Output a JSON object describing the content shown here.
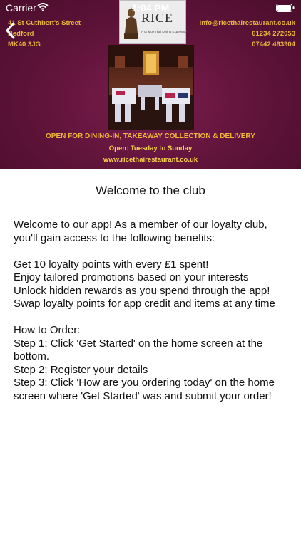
{
  "status_bar": {
    "carrier": "Carrier",
    "time": "1:04 PM"
  },
  "banner": {
    "address": [
      "41 St Cuthbert's Street",
      "Bedford",
      "MK40 3JG"
    ],
    "contact": [
      "info@ricethairestaurant.co.uk",
      "01234 272053",
      "07442 493904"
    ],
    "logo_text": "RICE",
    "logo_subtitle": "A Unique Thai Dining Experience",
    "tagline": "OPEN FOR DINING-IN, TAKEAWAY COLLECTION & DELIVERY",
    "hours": "Open: Tuesday to Sunday",
    "website": "www.ricethairestaurant.co.uk"
  },
  "content": {
    "title": "Welcome to the club",
    "intro": "Welcome to our app! As a member of our loyalty club, you'll gain access to the following benefits:",
    "benefits": [
      "Get 10 loyalty points with every £1 spent!",
      "Enjoy tailored promotions based on your interests",
      "Unlock hidden rewards as you spend through the app!",
      "Swap loyalty points for app credit and items at any time"
    ],
    "how_to_title": "How to Order:",
    "steps": [
      "Step 1: Click 'Get Started' on the home screen at the bottom.",
      "Step 2: Register your details",
      "Step 3: Click 'How are you ordering today' on the home screen where 'Get Started' was and submit your order!"
    ]
  },
  "colors": {
    "banner": "#5e1338",
    "accent": "#e9b53a"
  }
}
